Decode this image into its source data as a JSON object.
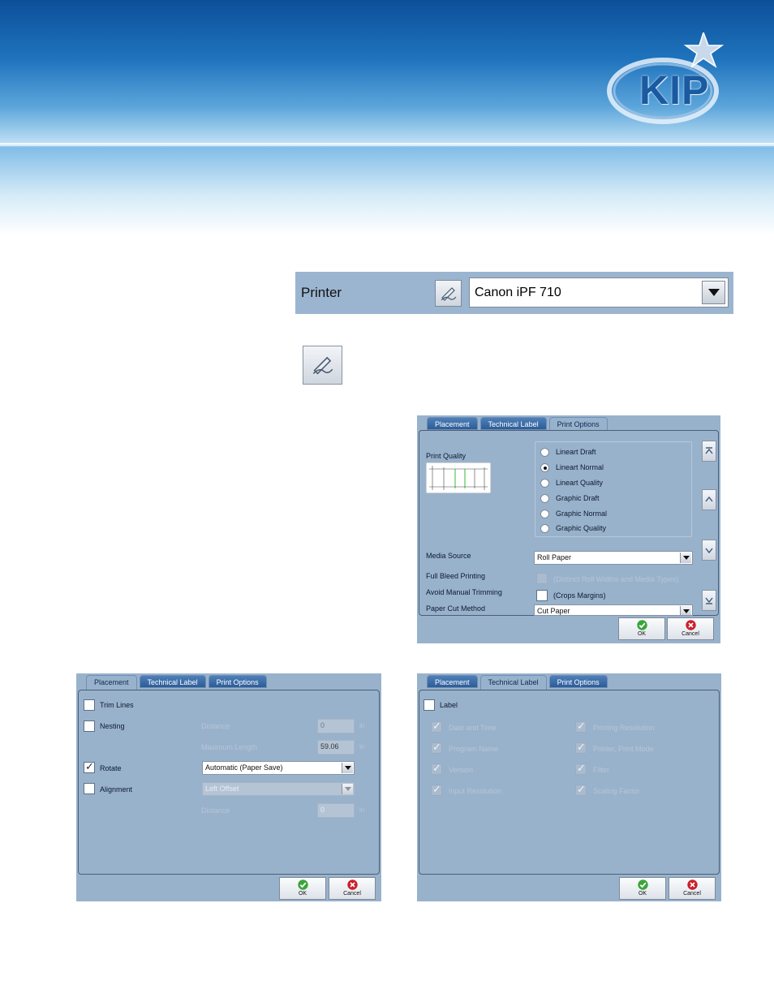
{
  "header": {
    "logo_text": "KIP"
  },
  "printer_bar": {
    "label": "Printer",
    "selected_printer": "Canon iPF 710",
    "edit_icon": "pen-edit-icon"
  },
  "print_options_dialog": {
    "tabs": [
      "Placement",
      "Technical Label",
      "Print Options"
    ],
    "active_tab": "Print Options",
    "print_quality_label": "Print Quality",
    "quality_options": [
      {
        "label": "Lineart Draft",
        "selected": false
      },
      {
        "label": "Lineart Normal",
        "selected": true
      },
      {
        "label": "Lineart Quality",
        "selected": false
      },
      {
        "label": "Graphic Draft",
        "selected": false
      },
      {
        "label": "Graphic Normal",
        "selected": false
      },
      {
        "label": "Graphic Quality",
        "selected": false
      }
    ],
    "media_source_label": "Media Source",
    "media_source_value": "Roll Paper",
    "full_bleed_label": "Full Bleed Printing",
    "full_bleed_note": "(Distinct Roll Widths and Media Types)",
    "avoid_trim_label": "Avoid Manual Trimming",
    "avoid_trim_note": "(Crops Margins)",
    "paper_cut_label": "Paper Cut Method",
    "paper_cut_value": "Cut Paper",
    "ok_label": "OK",
    "cancel_label": "Cancel"
  },
  "placement_dialog": {
    "tabs": [
      "Placement",
      "Technical Label",
      "Print Options"
    ],
    "active_tab": "Placement",
    "trim_lines_label": "Trim Lines",
    "nesting_label": "Nesting",
    "distance_label": "Distance",
    "distance_value": "0",
    "max_length_label": "Maximum Length",
    "max_length_value": "59.06",
    "rotate_label": "Rotate",
    "rotate_value": "Automatic (Paper Save)",
    "alignment_label": "Alignment",
    "alignment_value": "Left Offset",
    "align_distance_label": "Distance",
    "align_distance_value": "0",
    "unit": "in",
    "ok_label": "OK",
    "cancel_label": "Cancel"
  },
  "technical_label_dialog": {
    "tabs": [
      "Placement",
      "Technical Label",
      "Print Options"
    ],
    "active_tab": "Technical Label",
    "label_checkbox": "Label",
    "left_items": [
      "Date and Time",
      "Program Name",
      "Version",
      "Input Resolution"
    ],
    "right_items": [
      "Printing Resolution",
      "Printer, Print Mode",
      "Filter",
      "Scaling Factor"
    ],
    "ok_label": "OK",
    "cancel_label": "Cancel"
  }
}
